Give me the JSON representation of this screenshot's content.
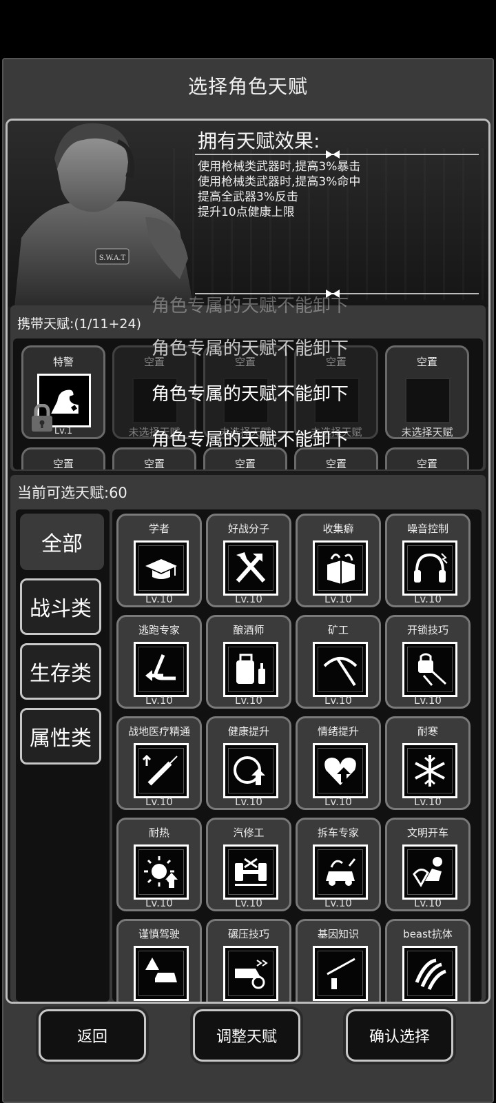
{
  "header": {
    "title": "选择角色天赋"
  },
  "hero": {
    "effects_title": "拥有天赋效果:",
    "effects": [
      "使用枪械类武器时,提高3%暴击",
      "使用枪械类武器时,提高3%命中",
      "提高全武器3%反击",
      "提升10点健康上限"
    ],
    "badge_text": "S.W.A.T"
  },
  "carried": {
    "label": "携带天赋:(1/11+24)",
    "slots": [
      {
        "name": "特警",
        "sub": "Lv.1",
        "filled": true
      },
      {
        "name": "空置",
        "sub": "未选择天赋",
        "filled": false
      },
      {
        "name": "空置",
        "sub": "未选择天赋",
        "filled": false
      },
      {
        "name": "空置",
        "sub": "未选择天赋",
        "filled": false
      },
      {
        "name": "空置",
        "sub": "未选择天赋",
        "filled": false
      }
    ],
    "row2": [
      "空置",
      "空置",
      "空置",
      "空置",
      "空置"
    ],
    "toast": "角色专属的天赋不能卸下"
  },
  "available": {
    "label": "当前可选天赋:60",
    "categories": [
      "全部",
      "战斗类",
      "生存类",
      "属性类"
    ],
    "talents": [
      {
        "name": "学者",
        "level": "Lv.10",
        "icon": "graduation-cap-icon"
      },
      {
        "name": "好战分子",
        "level": "Lv.10",
        "icon": "crossed-tools-icon"
      },
      {
        "name": "收集癖",
        "level": "Lv.10",
        "icon": "box-icon"
      },
      {
        "name": "噪音控制",
        "level": "Lv.10",
        "icon": "headphones-icon"
      },
      {
        "name": "逃跑专家",
        "level": "Lv.10",
        "icon": "escape-arrow-icon"
      },
      {
        "name": "酿酒师",
        "level": "Lv.10",
        "icon": "distillery-icon"
      },
      {
        "name": "矿工",
        "level": "Lv.10",
        "icon": "pickaxe-icon"
      },
      {
        "name": "开锁技巧",
        "level": "Lv.10",
        "icon": "lockpick-icon"
      },
      {
        "name": "战地医疗精通",
        "level": "Lv.10",
        "icon": "syringe-icon"
      },
      {
        "name": "健康提升",
        "level": "Lv.10",
        "icon": "health-up-icon"
      },
      {
        "name": "情绪提升",
        "level": "Lv.10",
        "icon": "heart-up-icon"
      },
      {
        "name": "耐寒",
        "level": "Lv.10",
        "icon": "snowflake-icon"
      },
      {
        "name": "耐热",
        "level": "Lv.10",
        "icon": "sun-icon"
      },
      {
        "name": "汽修工",
        "level": "Lv.10",
        "icon": "car-repair-icon"
      },
      {
        "name": "拆车专家",
        "level": "Lv.10",
        "icon": "car-dismantle-icon"
      },
      {
        "name": "文明开车",
        "level": "Lv.10",
        "icon": "driver-icon"
      },
      {
        "name": "谨慎驾驶",
        "level": "",
        "icon": "warning-car-icon"
      },
      {
        "name": "碾压技巧",
        "level": "",
        "icon": "crush-icon"
      },
      {
        "name": "基因知识",
        "level": "",
        "icon": "gene-icon"
      },
      {
        "name": "beast抗体",
        "level": "",
        "icon": "claw-icon"
      }
    ]
  },
  "footer": {
    "back": "返回",
    "adjust": "调整天赋",
    "confirm": "确认选择"
  }
}
